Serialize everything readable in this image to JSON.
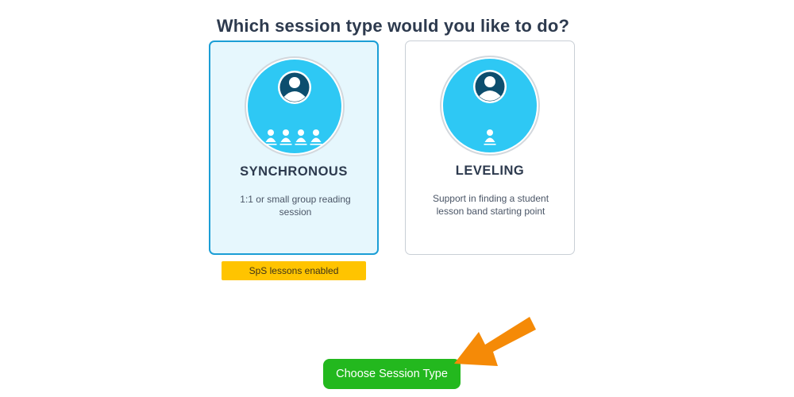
{
  "header": {
    "title": "Which session type would you like to do?"
  },
  "session_types": [
    {
      "title": "SYNCHRONOUS",
      "description": "1:1 or small group reading session",
      "icon": "teacher-with-group-icon",
      "selected": true,
      "badge": "SpS lessons enabled"
    },
    {
      "title": "LEVELING",
      "description": "Support in finding a student lesson band starting point",
      "icon": "teacher-with-student-icon",
      "selected": false
    }
  ],
  "actions": {
    "choose_label": "Choose Session Type"
  },
  "colors": {
    "accent_blue": "#1b9ed6",
    "icon_circle": "#2ec8f4",
    "selected_card_bg": "#e6f7fd",
    "badge_yellow": "#ffc400",
    "button_green": "#23b81e",
    "arrow_orange": "#f58a07",
    "title_text": "#2d3a4e"
  }
}
